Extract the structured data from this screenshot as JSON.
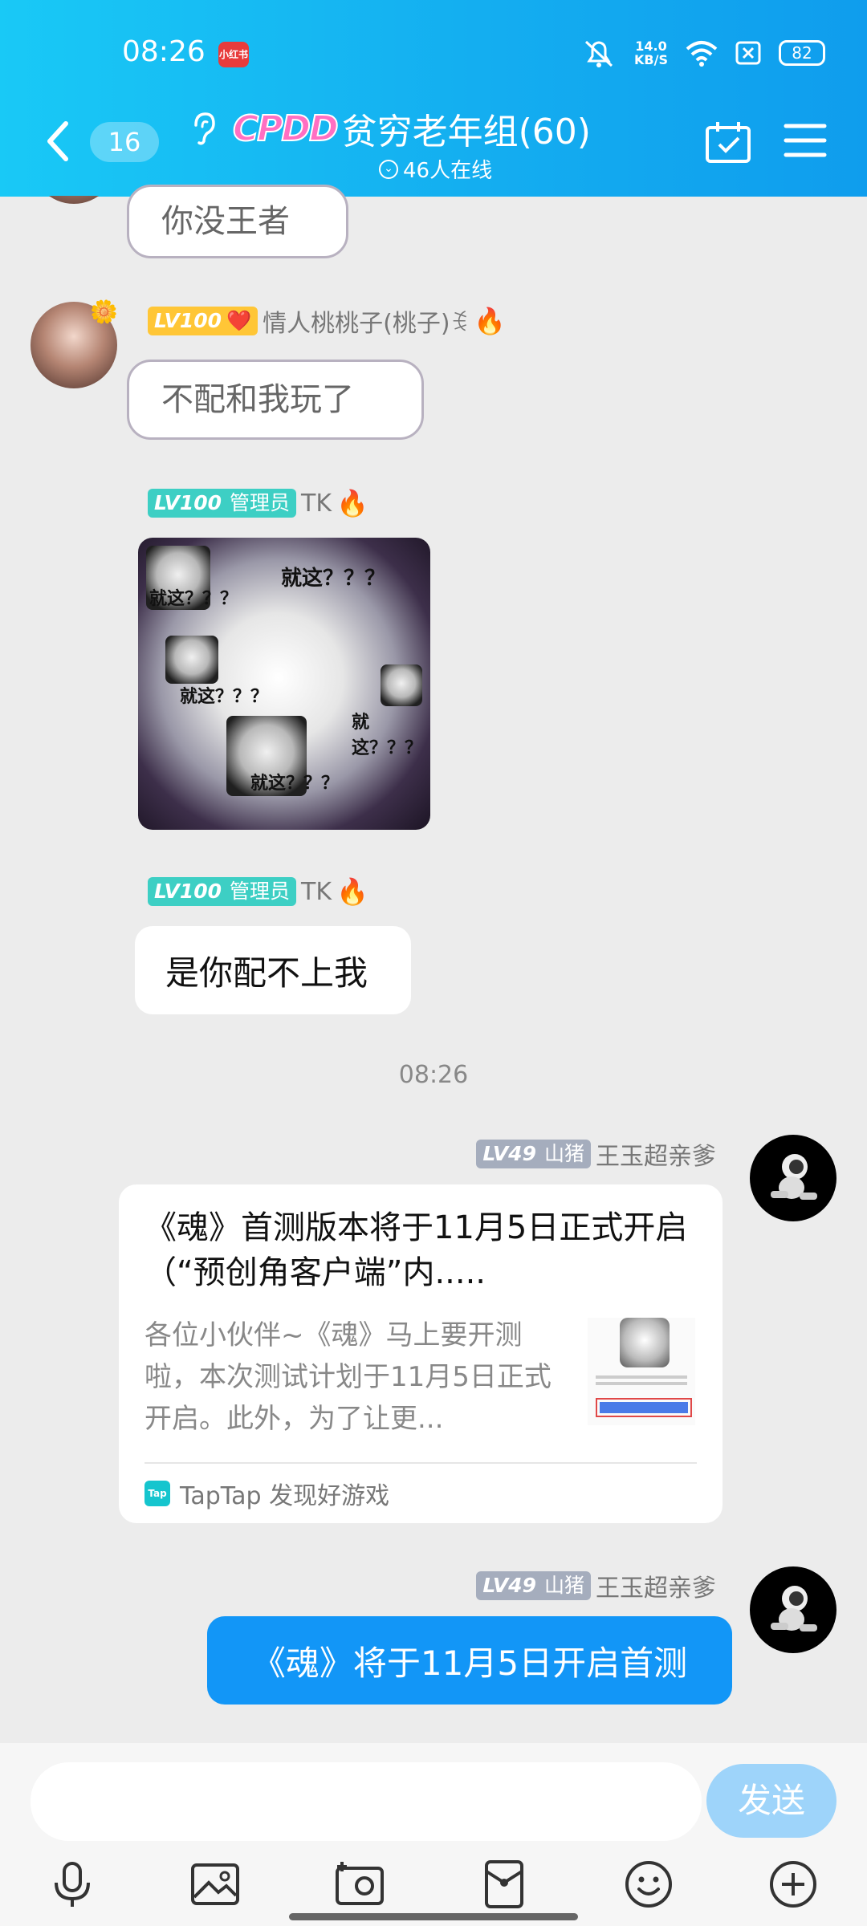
{
  "status_bar": {
    "time": "08:26",
    "app_badge": "小红书",
    "net_speed_value": "14.0",
    "net_speed_unit": "KB/S",
    "battery": "82"
  },
  "header": {
    "unread_count": "16",
    "group_logo": "CPDD",
    "group_title": "贫穷老年组(60)",
    "online_text": "46人在线"
  },
  "messages": [
    {
      "type": "sticker_text",
      "text": "你没王者"
    },
    {
      "type": "sticker_text",
      "level": "LV100",
      "badge_emoji": "❤️",
      "sender": "情人桃桃子(桃子)ꉂ",
      "fire": "🔥",
      "text": "不配和我玩了"
    },
    {
      "type": "image",
      "level": "LV100",
      "role": "管理员",
      "sender": "TK",
      "fire": "🔥",
      "image_texts": [
        "就这？？？",
        "就这？？？",
        "就这？？？",
        "就这？？？",
        "就这？？？"
      ]
    },
    {
      "type": "text",
      "level": "LV100",
      "role": "管理员",
      "sender": "TK",
      "fire": "🔥",
      "text": "是你配不上我"
    },
    {
      "type": "time",
      "text": "08:26"
    },
    {
      "type": "share",
      "level": "LV49",
      "role": "山猪",
      "sender": "王玉超亲爹",
      "title": "《魂》首测版本将于11月5日正式开启（“预创角客户端”内.....",
      "desc": "各位小伙伴~《魂》马上要开测啦，本次测试计划于11月5日正式开启。此外，为了让更...",
      "source_icon": "Tap",
      "source": "TapTap 发现好游戏"
    },
    {
      "type": "text",
      "level": "LV49",
      "role": "山猪",
      "sender": "王玉超亲爹",
      "text": "《魂》将于11月5日开启首测"
    }
  ],
  "input": {
    "placeholder": "",
    "send_label": "发送"
  },
  "toolbar": [
    "mic-icon",
    "image-icon",
    "camera-icon",
    "red-packet-icon",
    "emoji-icon",
    "plus-icon"
  ],
  "colors": {
    "header_start": "#19c9f6",
    "header_end": "#0f9ded",
    "bubble_blue": "#1296f7",
    "send_btn": "#9ed4fa",
    "admin_badge": "#3dcfc4",
    "level_badge_gold": "#ffc636",
    "level_badge_grey": "#a5adbd"
  }
}
